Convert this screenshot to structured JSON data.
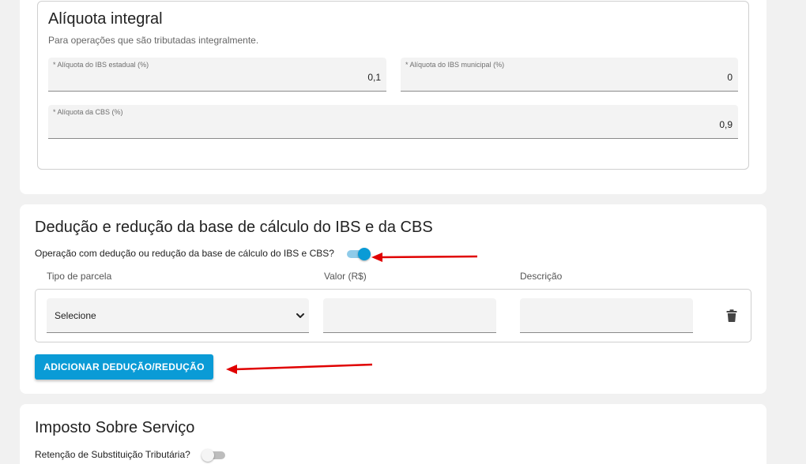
{
  "aliquota_integral": {
    "title": "Alíquota integral",
    "subtitle": "Para operações que são tributadas integralmente.",
    "ibs_estadual": {
      "label": "* Alíquota do IBS estadual (%)",
      "value": "0,1"
    },
    "ibs_municipal": {
      "label": "* Alíquota do IBS municipal (%)",
      "value": "0"
    },
    "cbs": {
      "label": "* Alíquota da CBS (%)",
      "value": "0,9"
    }
  },
  "deducao": {
    "title": "Dedução e redução da base de cálculo do IBS e da CBS",
    "toggle_label": "Operação com dedução ou redução da base de cálculo do IBS e CBS?",
    "toggle_on": true,
    "columns": {
      "tipo": "Tipo de parcela",
      "valor": "Valor (R$)",
      "descricao": "Descrição"
    },
    "row": {
      "tipo_selected": "Selecione",
      "valor": "",
      "descricao": ""
    },
    "add_button": "ADICIONAR DEDUÇÃO/REDUÇÃO"
  },
  "iss": {
    "title": "Imposto Sobre Serviço",
    "toggle_label": "Retenção de Substituição Tributária?",
    "toggle_on": false
  },
  "colors": {
    "accent": "#0a9bd6",
    "annotation_arrow": "#e00000",
    "background": "#f1f1f1",
    "card": "#ffffff"
  },
  "icons": {
    "select_chevron": "chevron-down-icon",
    "delete": "trash-icon"
  }
}
